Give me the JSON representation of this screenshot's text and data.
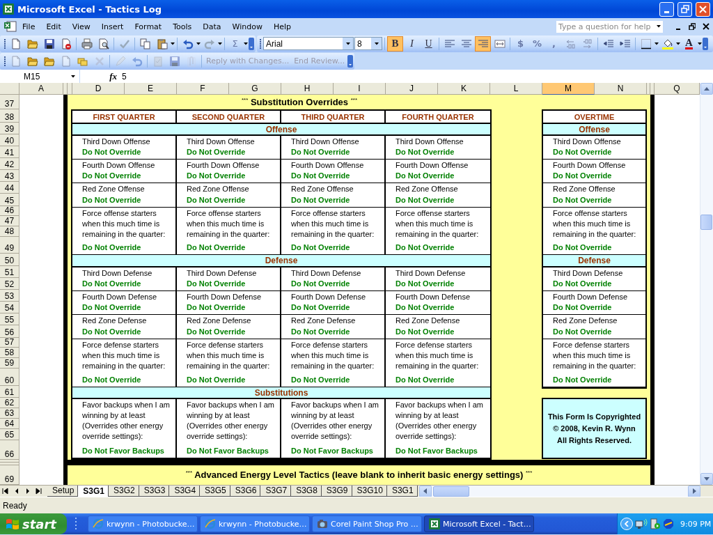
{
  "window": {
    "title": "Microsoft Excel - Tactics Log"
  },
  "menu": [
    "File",
    "Edit",
    "View",
    "Insert",
    "Format",
    "Tools",
    "Data",
    "Window",
    "Help"
  ],
  "help_field": {
    "placeholder": "Type a question for help"
  },
  "standard_toolbar": {
    "sum_button": "Σ"
  },
  "formatting_toolbar": {
    "font": "Arial",
    "size": "8",
    "style_buttons": [
      {
        "label": "B",
        "selected": true
      },
      {
        "label": "I",
        "selected": false
      },
      {
        "label": "U",
        "selected": false
      }
    ],
    "align_buttons": [
      {
        "selected": false
      },
      {
        "selected": false
      },
      {
        "selected": true
      }
    ],
    "number_buttons": [
      "$",
      "%",
      ","
    ],
    "font_color_label": "A"
  },
  "reviewing_toolbar": {
    "buttons": [
      {
        "label": "Reply with Changes...",
        "disabled": true
      },
      {
        "label": "End Review...",
        "disabled": true
      }
    ]
  },
  "formula_bar": {
    "name_box": "M15",
    "fx_label": "fx",
    "value": "5"
  },
  "columns": [
    {
      "label": "A",
      "selected": false
    },
    {
      "label": "D",
      "selected": false
    },
    {
      "label": "E",
      "selected": false
    },
    {
      "label": "F",
      "selected": false
    },
    {
      "label": "G",
      "selected": false
    },
    {
      "label": "H",
      "selected": false
    },
    {
      "label": "I",
      "selected": false
    },
    {
      "label": "J",
      "selected": false
    },
    {
      "label": "K",
      "selected": false
    },
    {
      "label": "L",
      "selected": false
    },
    {
      "label": "M",
      "selected": true
    },
    {
      "label": "N",
      "selected": false
    },
    {
      "label": "Q",
      "selected": false
    }
  ],
  "rows": [
    "37",
    "38",
    "39",
    "40",
    "41",
    "42",
    "43",
    "44",
    "45",
    "46",
    "47",
    "48",
    "49",
    "50",
    "51",
    "52",
    "53",
    "54",
    "55",
    "56",
    "57",
    "58",
    "59",
    "60",
    "61",
    "62",
    "63",
    "64",
    "65",
    "66",
    "69"
  ],
  "form": {
    "title": "$^{***}$ Substitution Overrides $^{***}$",
    "section_headings": [
      "Offense",
      "Defense",
      "Substitutions"
    ],
    "quarters": [
      {
        "heading": "FIRST QUARTER",
        "offense": [
          {
            "label": "Third Down Offense",
            "value": "Do Not Override"
          },
          {
            "label": "Fourth Down Offense",
            "value": "Do Not Override"
          },
          {
            "label": "Red Zone Offense",
            "value": "Do Not Override"
          },
          {
            "label": "Force offense starters when this much time is remaining in the quarter:",
            "value": "Do Not Override"
          }
        ],
        "defense": [
          {
            "label": "Third Down Defense",
            "value": "Do Not Override"
          },
          {
            "label": "Fourth Down Defense",
            "value": "Do Not Override"
          },
          {
            "label": "Red Zone Defense",
            "value": "Do Not Override"
          },
          {
            "label": "Force defense starters when this much time is remaining in the quarter:",
            "value": "Do Not Override"
          }
        ],
        "substitutions": [
          {
            "label": "Favor backups when I am winning by at least (Overrides other energy override settings):",
            "value": "Do Not Favor Backups"
          }
        ]
      },
      {
        "heading": "SECOND QUARTER",
        "offense": [
          {
            "label": "Third Down Offense",
            "value": "Do Not Override"
          },
          {
            "label": "Fourth Down Offense",
            "value": "Do Not Override"
          },
          {
            "label": "Red Zone Offense",
            "value": "Do Not Override"
          },
          {
            "label": "Force offense starters when this much time is remaining in the quarter:",
            "value": "Do Not Override"
          }
        ],
        "defense": [
          {
            "label": "Third Down Defense",
            "value": "Do Not Override"
          },
          {
            "label": "Fourth Down Defense",
            "value": "Do Not Override"
          },
          {
            "label": "Red Zone Defense",
            "value": "Do Not Override"
          },
          {
            "label": "Force defense starters when this much time is remaining in the quarter:",
            "value": "Do Not Override"
          }
        ],
        "substitutions": [
          {
            "label": "Favor backups when I am winning by at least (Overrides other energy override settings):",
            "value": "Do Not Favor Backups"
          }
        ]
      },
      {
        "heading": "THIRD QUARTER",
        "offense": [
          {
            "label": "Third Down Offense",
            "value": "Do Not Override"
          },
          {
            "label": "Fourth Down Offense",
            "value": "Do Not Override"
          },
          {
            "label": "Red Zone Offense",
            "value": "Do Not Override"
          },
          {
            "label": "Force offense starters when this much time is remaining in the quarter:",
            "value": "Do Not Override"
          }
        ],
        "defense": [
          {
            "label": "Third Down Defense",
            "value": "Do Not Override"
          },
          {
            "label": "Fourth Down Defense",
            "value": "Do Not Override"
          },
          {
            "label": "Red Zone Defense",
            "value": "Do Not Override"
          },
          {
            "label": "Force defense starters when this much time is remaining in the quarter:",
            "value": "Do Not Override"
          }
        ],
        "substitutions": [
          {
            "label": "Favor backups when I am winning by at least (Overrides other energy override settings):",
            "value": "Do Not Favor Backups"
          }
        ]
      },
      {
        "heading": "FOURTH QUARTER",
        "offense": [
          {
            "label": "Third Down Offense",
            "value": "Do Not Override"
          },
          {
            "label": "Fourth Down Offense",
            "value": "Do Not Override"
          },
          {
            "label": "Red Zone Offense",
            "value": "Do Not Override"
          },
          {
            "label": "Force offense starters when this much time is remaining in the quarter:",
            "value": "Do Not Override"
          }
        ],
        "defense": [
          {
            "label": "Third Down Defense",
            "value": "Do Not Override"
          },
          {
            "label": "Fourth Down Defense",
            "value": "Do Not Override"
          },
          {
            "label": "Red Zone Defense",
            "value": "Do Not Override"
          },
          {
            "label": "Force defense starters when this much time is remaining in the quarter:",
            "value": "Do Not Override"
          }
        ],
        "substitutions": [
          {
            "label": "Favor backups when I am winning by at least (Overrides other energy override settings):",
            "value": "Do Not Favor Backups"
          }
        ]
      }
    ],
    "overtime": {
      "heading": "OVERTIME",
      "section_headings": [
        "Offense",
        "Defense"
      ],
      "offense": [
        {
          "label": "Third Down Offense",
          "value": "Do Not Override"
        },
        {
          "label": "Fourth Down Offense",
          "value": "Do Not Override"
        },
        {
          "label": "Red Zone Offense",
          "value": "Do Not Override"
        },
        {
          "label": "Force offense starters when this much time is remaining in the quarter:",
          "value": "Do Not Override"
        }
      ],
      "defense": [
        {
          "label": "Third Down Defense",
          "value": "Do Not Override"
        },
        {
          "label": "Fourth Down Defense",
          "value": "Do Not Override"
        },
        {
          "label": "Red Zone Defense",
          "value": "Do Not Override"
        },
        {
          "label": "Force defense starters when this much time is remaining in the quarter:",
          "value": "Do Not Override"
        }
      ]
    },
    "copyright": [
      "This Form Is Copyrighted",
      "© 2008, Kevin R. Wynn",
      "All Rights Reserved."
    ],
    "next_title": "$^{***}$ Advanced Energy Level Tactics (leave blank to inherit basic energy settings) $^{***}$"
  },
  "sheet_tabs": [
    {
      "label": "Setup",
      "selected": false
    },
    {
      "label": "S3G1",
      "selected": true
    },
    {
      "label": "S3G2",
      "selected": false
    },
    {
      "label": "S3G3",
      "selected": false
    },
    {
      "label": "S3G4",
      "selected": false
    },
    {
      "label": "S3G5",
      "selected": false
    },
    {
      "label": "S3G6",
      "selected": false
    },
    {
      "label": "S3G7",
      "selected": false
    },
    {
      "label": "S3G8",
      "selected": false
    },
    {
      "label": "S3G9",
      "selected": false
    },
    {
      "label": "S3G10",
      "selected": false
    },
    {
      "label": "S3G1",
      "selected": false
    }
  ],
  "status_bar": "Ready",
  "taskbar": {
    "start": "start",
    "tasks": [
      {
        "label": "krwynn - Photobucke…",
        "kind": "browser",
        "selected": false
      },
      {
        "label": "krwynn - Photobucke…",
        "kind": "browser",
        "selected": false
      },
      {
        "label": "Corel Paint Shop Pro …",
        "kind": "paint",
        "selected": false
      },
      {
        "label": "Microsoft Excel - Tact…",
        "kind": "excel",
        "selected": true
      }
    ],
    "clock": "9:09 PM"
  }
}
